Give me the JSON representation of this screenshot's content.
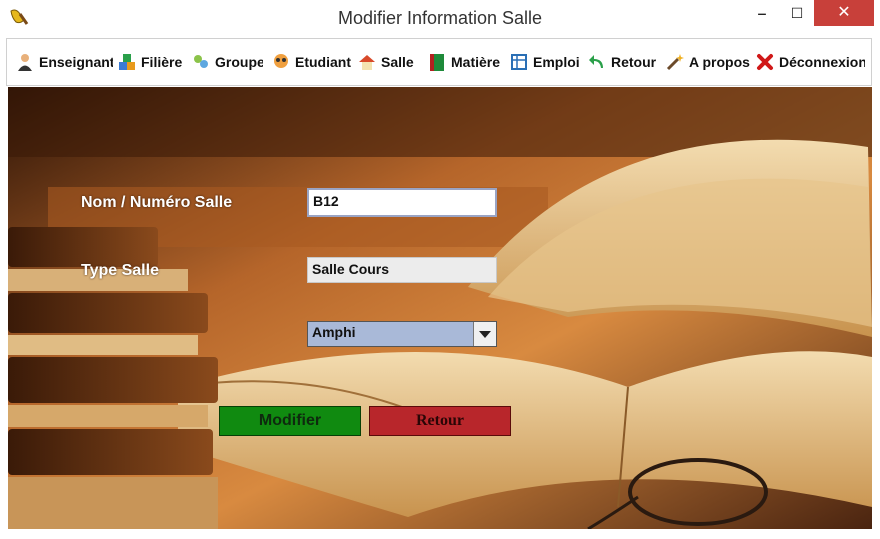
{
  "window": {
    "title": "Modifier Information Salle",
    "app_icon": "broom-icon",
    "controls": {
      "minimize": "‒",
      "maximize": "☐",
      "close": "✕"
    }
  },
  "menu": {
    "items": [
      {
        "label": "Enseignant",
        "icon": "teacher-icon"
      },
      {
        "label": "Filière",
        "icon": "blocks-icon"
      },
      {
        "label": "Groupe",
        "icon": "group-icon"
      },
      {
        "label": "Etudiant",
        "icon": "students-icon"
      },
      {
        "label": "Salle",
        "icon": "house-icon"
      },
      {
        "label": "Matière",
        "icon": "book-icon"
      },
      {
        "label": "Emploi",
        "icon": "schedule-icon"
      },
      {
        "label": "Retour",
        "icon": "back-arrow-icon"
      },
      {
        "label": "A propos",
        "icon": "magic-wand-icon"
      },
      {
        "label": "Déconnexion",
        "icon": "red-x-icon"
      }
    ]
  },
  "form": {
    "name_label": "Nom / Numéro Salle",
    "name_value": "B12",
    "type_label": "Type Salle",
    "type_value": "Salle Cours",
    "select_value": "Amphi",
    "modify_button": "Modifier",
    "back_button": "Retour"
  },
  "colors": {
    "close_button": "#c8403a",
    "modify_button": "#108a10",
    "back_button": "#b8262b",
    "select_bg": "#a9b9d8"
  }
}
